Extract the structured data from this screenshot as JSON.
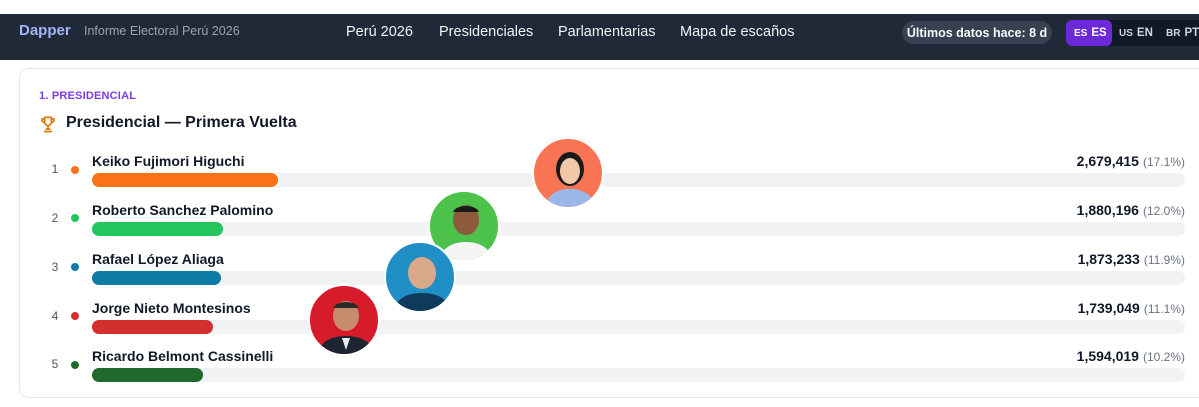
{
  "header": {
    "brand": "Dapper",
    "subtitle": "Informe Electoral Perú 2026",
    "nav": [
      "Perú 2026",
      "Presidenciales",
      "Parlamentarias",
      "Mapa de escaños"
    ],
    "status": "Últimos datos hace: 8 d",
    "languages": [
      {
        "flag": "ES",
        "code": "ES",
        "active": true
      },
      {
        "flag": "US",
        "code": "EN",
        "active": false
      },
      {
        "flag": "BR",
        "code": "PT",
        "active": false
      }
    ]
  },
  "section": {
    "kicker": "1. PRESIDENCIAL",
    "title": "Presidencial — Primera Vuelta",
    "icon": "trophy-icon"
  },
  "candidates": [
    {
      "rank": "1",
      "name": "Keiko Fujimori Higuchi",
      "votes": "2,679,415",
      "pct": "(17.1%)",
      "share": 17.1,
      "color": "#f97316",
      "avatar_bg": "#f87455"
    },
    {
      "rank": "2",
      "name": "Roberto Sanchez Palomino",
      "votes": "1,880,196",
      "pct": "(12.0%)",
      "share": 12.0,
      "color": "#22c55e",
      "avatar_bg": "#4cc24a"
    },
    {
      "rank": "3",
      "name": "Rafael López Aliaga",
      "votes": "1,873,233",
      "pct": "(11.9%)",
      "share": 11.9,
      "color": "#0e7aa6",
      "avatar_bg": "#1f8fc6"
    },
    {
      "rank": "4",
      "name": "Jorge Nieto Montesinos",
      "votes": "1,739,049",
      "pct": "(11.1%)",
      "share": 11.1,
      "color": "#d32f2f",
      "avatar_bg": "#d81b2a"
    },
    {
      "rank": "5",
      "name": "Ricardo Belmont Cassinelli",
      "votes": "1,594,019",
      "pct": "(10.2%)",
      "share": 10.2,
      "color": "#1f6a2a"
    }
  ]
}
